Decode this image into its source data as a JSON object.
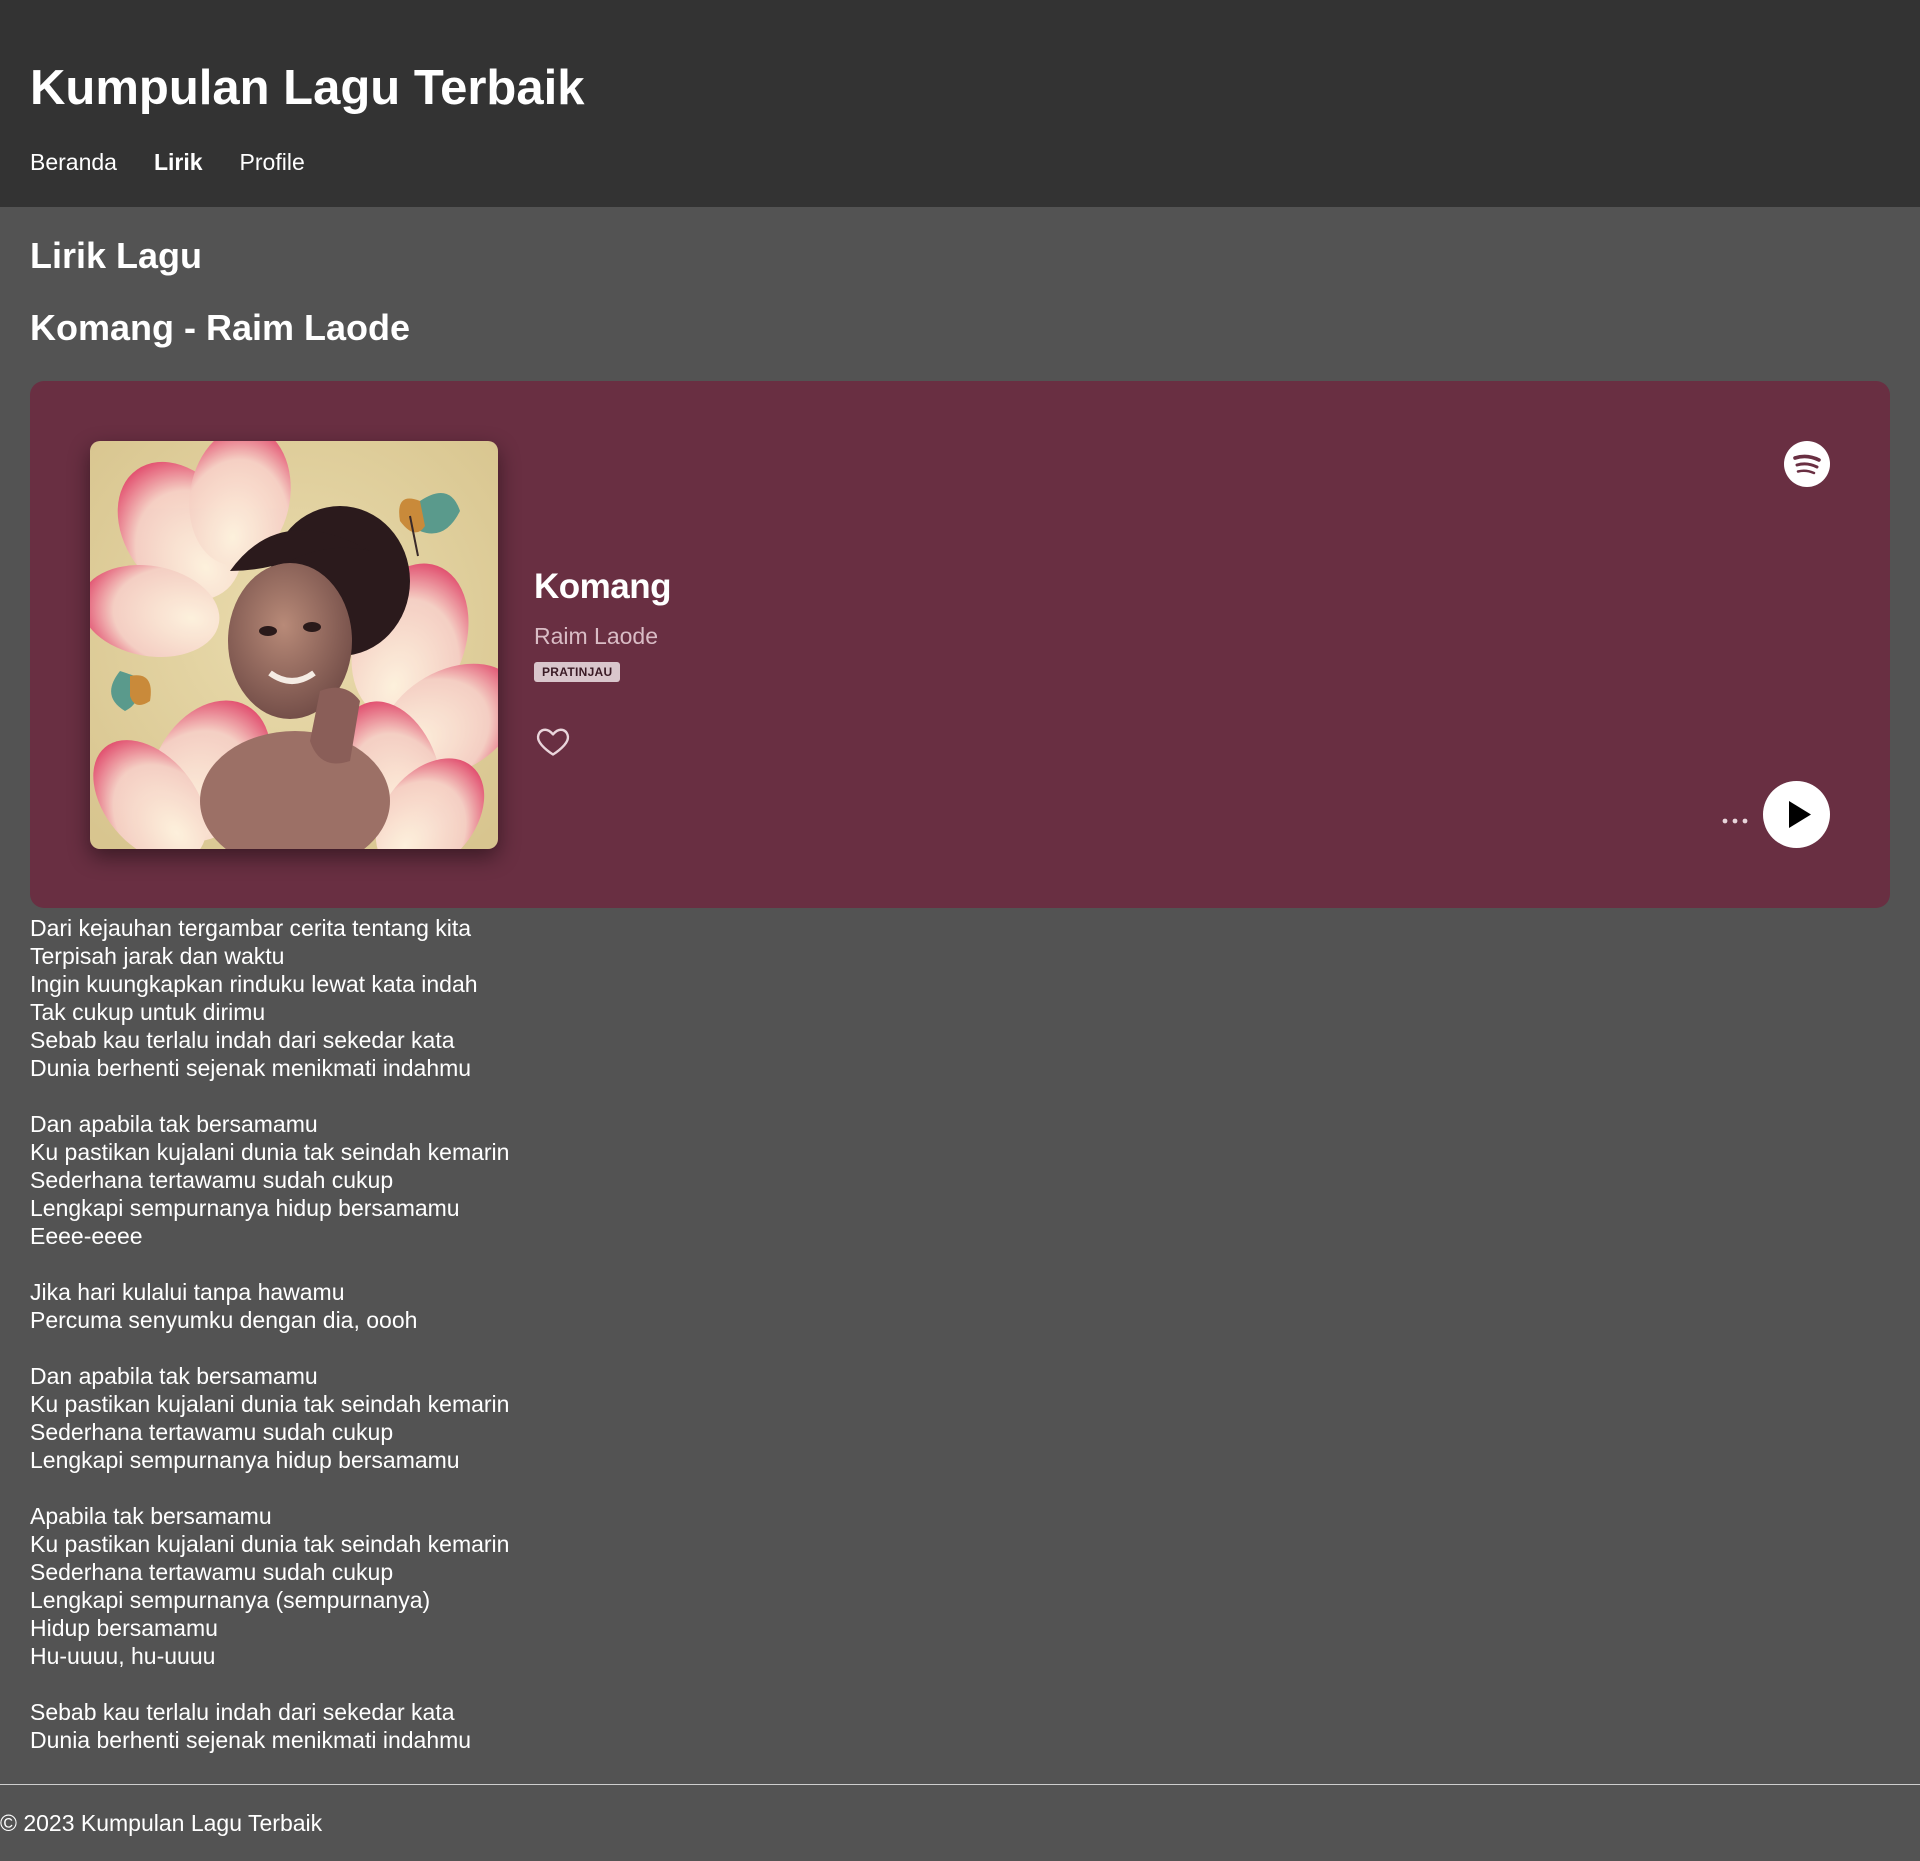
{
  "site": {
    "title": "Kumpulan Lagu Terbaik"
  },
  "nav": {
    "items": [
      {
        "label": "Beranda",
        "active": false
      },
      {
        "label": "Lirik",
        "active": true
      },
      {
        "label": "Profile",
        "active": false
      }
    ]
  },
  "page": {
    "heading": "Lirik Lagu",
    "song_heading": "Komang - Raim Laode"
  },
  "player": {
    "track_title": "Komang",
    "artist": "Raim Laode",
    "badge": "PRATINJAU",
    "background_color": "#692f42",
    "icons": [
      "spotify-logo-icon",
      "heart-icon",
      "more-options-icon",
      "play-icon"
    ]
  },
  "lyrics": {
    "text": "Dari kejauhan tergambar cerita tentang kita\nTerpisah jarak dan waktu\nIngin kuungkapkan rinduku lewat kata indah\nTak cukup untuk dirimu\nSebab kau terlalu indah dari sekedar kata\nDunia berhenti sejenak menikmati indahmu\n\nDan apabila tak bersamamu\nKu pastikan kujalani dunia tak seindah kemarin\nSederhana tertawamu sudah cukup\nLengkapi sempurnanya hidup bersamamu\nEeee-eeee\n\nJika hari kulalui tanpa hawamu\nPercuma senyumku dengan dia, oooh\n\nDan apabila tak bersamamu\nKu pastikan kujalani dunia tak seindah kemarin\nSederhana tertawamu sudah cukup\nLengkapi sempurnanya hidup bersamamu\n\nApabila tak bersamamu\nKu pastikan kujalani dunia tak seindah kemarin\nSederhana tertawamu sudah cukup\nLengkapi sempurnanya (sempurnanya)\nHidup bersamamu\nHu-uuuu, hu-uuuu\n\nSebab kau terlalu indah dari sekedar kata\nDunia berhenti sejenak menikmati indahmu"
  },
  "footer": {
    "copyright": "© 2023 Kumpulan Lagu Terbaik"
  },
  "colors": {
    "header_bg": "#333333",
    "page_bg": "#535353",
    "embed_bg": "#692f42"
  }
}
